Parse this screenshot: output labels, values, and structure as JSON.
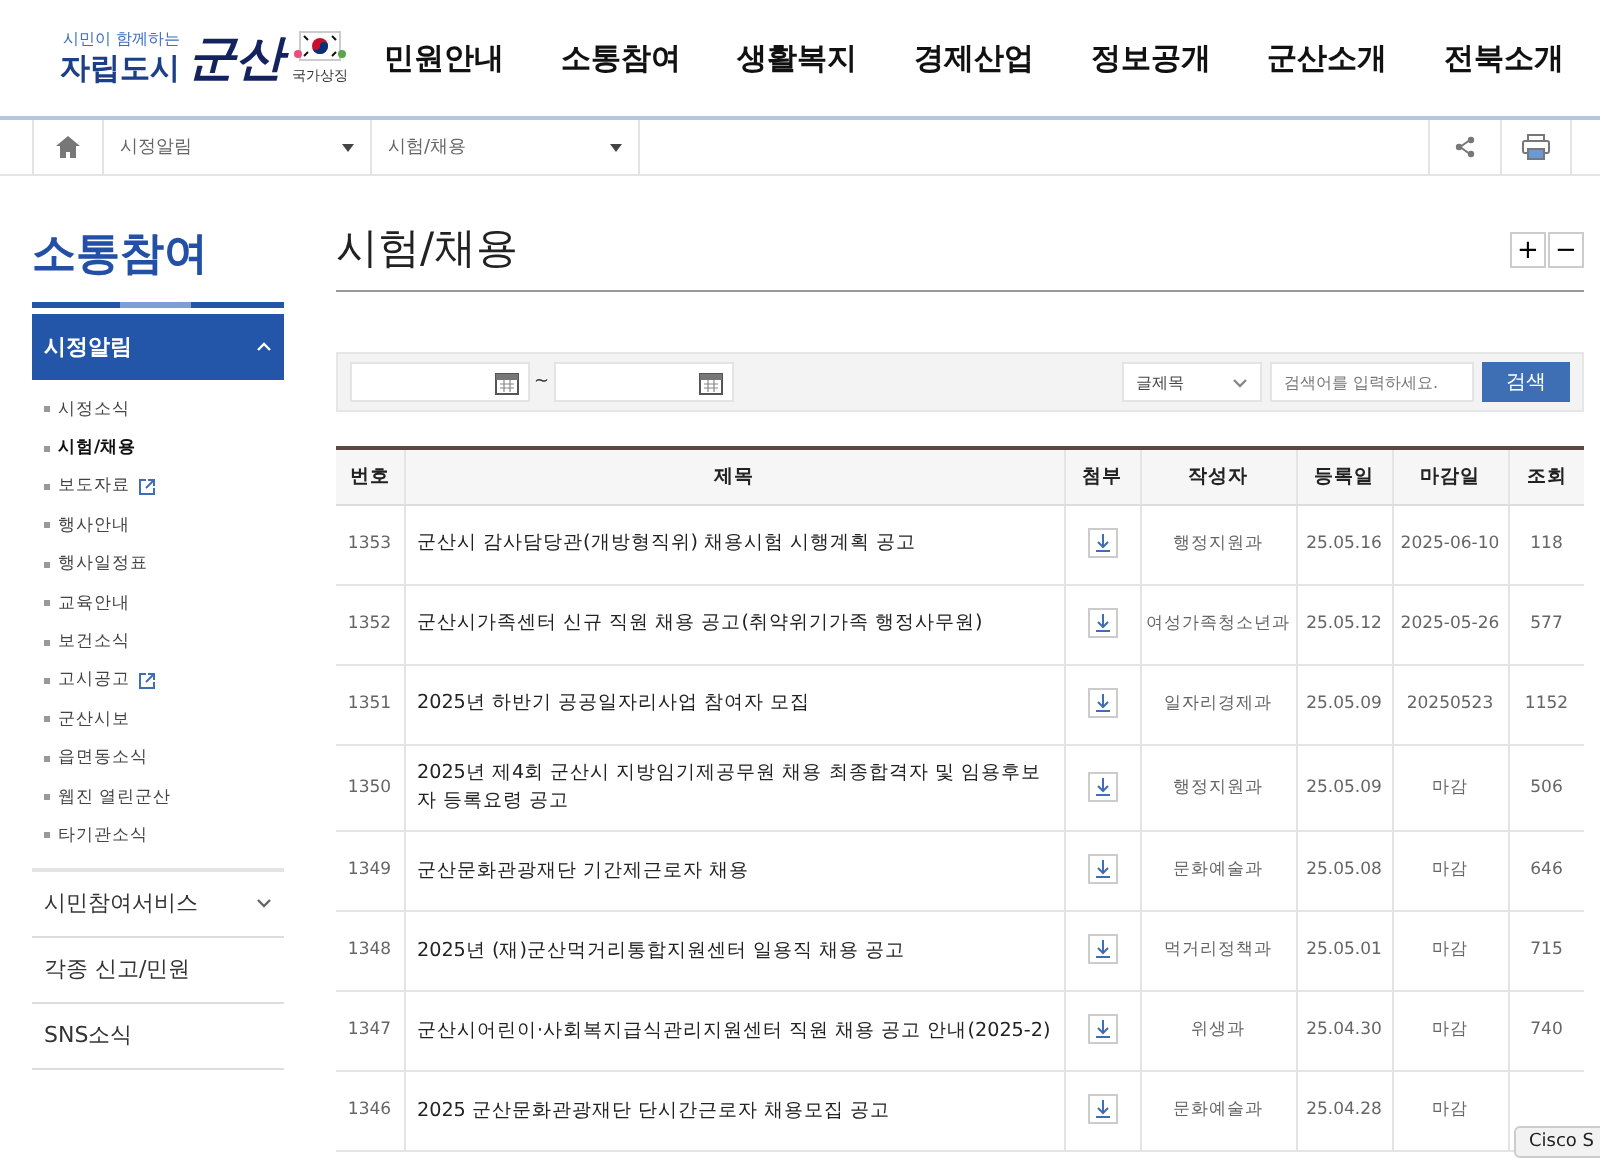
{
  "header": {
    "logo": {
      "tagline": "시민이 함께하는",
      "slogan": "자립도시",
      "city": "군산",
      "symbol_label": "국가상징"
    },
    "nav": [
      "민원안내",
      "소통참여",
      "생활복지",
      "경제산업",
      "정보공개",
      "군산소개",
      "전북소개"
    ]
  },
  "breadcrumb": [
    "시정알림",
    "시험/채용"
  ],
  "sidebar": {
    "title": "소통참여",
    "groups": [
      {
        "label": "시정알림",
        "kind": "folder",
        "expanded": true,
        "children": [
          {
            "label": "시정소식",
            "selected": false,
            "external": false
          },
          {
            "label": "시험/채용",
            "selected": true,
            "external": false
          },
          {
            "label": "보도자료",
            "selected": false,
            "external": true
          },
          {
            "label": "행사안내",
            "selected": false,
            "external": false
          },
          {
            "label": "행사일정표",
            "selected": false,
            "external": false
          },
          {
            "label": "교육안내",
            "selected": false,
            "external": false
          },
          {
            "label": "보건소식",
            "selected": false,
            "external": false
          },
          {
            "label": "고시공고",
            "selected": false,
            "external": true
          },
          {
            "label": "군산시보",
            "selected": false,
            "external": false
          },
          {
            "label": "읍면동소식",
            "selected": false,
            "external": false
          },
          {
            "label": "웹진 열린군산",
            "selected": false,
            "external": false
          },
          {
            "label": "타기관소식",
            "selected": false,
            "external": false
          }
        ]
      },
      {
        "label": "시민참여서비스",
        "kind": "folder",
        "expanded": false
      },
      {
        "label": "각종 신고/민원",
        "kind": "link"
      },
      {
        "label": "SNS소식",
        "kind": "link"
      }
    ]
  },
  "page_title": "시험/채용",
  "zoom_buttons": [
    "+",
    "−"
  ],
  "search": {
    "range_separator": "~",
    "field_select": "글제목",
    "placeholder": "검색어를 입력하세요.",
    "button": "검색"
  },
  "table": {
    "columns": [
      "번호",
      "제목",
      "첨부",
      "작성자",
      "등록일",
      "마감일",
      "조회"
    ],
    "rows": [
      {
        "number": "1353",
        "title": "군산시 감사담당관(개방형직위) 채용시험 시행계획 공고",
        "attachment": true,
        "author": "행정지원과",
        "registered": "25.05.16",
        "deadline": "2025-06-10",
        "views": "118"
      },
      {
        "number": "1352",
        "title": "군산시가족센터 신규 직원 채용 공고(취약위기가족 행정사무원)",
        "attachment": true,
        "author": "여성가족청소년과",
        "registered": "25.05.12",
        "deadline": "2025-05-26",
        "views": "577"
      },
      {
        "number": "1351",
        "title": "2025년 하반기 공공일자리사업 참여자 모집",
        "attachment": true,
        "author": "일자리경제과",
        "registered": "25.05.09",
        "deadline": "20250523",
        "views": "1152"
      },
      {
        "number": "1350",
        "title": "2025년 제4회 군산시 지방임기제공무원 채용 최종합격자 및 임용후보자 등록요령 공고",
        "attachment": true,
        "author": "행정지원과",
        "registered": "25.05.09",
        "deadline": "마감",
        "views": "506"
      },
      {
        "number": "1349",
        "title": "군산문화관광재단 기간제근로자 채용",
        "attachment": true,
        "author": "문화예술과",
        "registered": "25.05.08",
        "deadline": "마감",
        "views": "646"
      },
      {
        "number": "1348",
        "title": "2025년 (재)군산먹거리통합지원센터 일용직 채용 공고",
        "attachment": true,
        "author": "먹거리정책과",
        "registered": "25.05.01",
        "deadline": "마감",
        "views": "715"
      },
      {
        "number": "1347",
        "title": "군산시어린이·사회복지급식관리지원센터 직원 채용 공고 안내(2025-2)",
        "attachment": true,
        "author": "위생과",
        "registered": "25.04.30",
        "deadline": "마감",
        "views": "740"
      },
      {
        "number": "1346",
        "title": "2025 군산문화관광재단 단시간근로자 채용모집 공고",
        "attachment": true,
        "author": "문화예술과",
        "registered": "25.04.28",
        "deadline": "마감"
      }
    ]
  },
  "tooltip": "Cisco S"
}
